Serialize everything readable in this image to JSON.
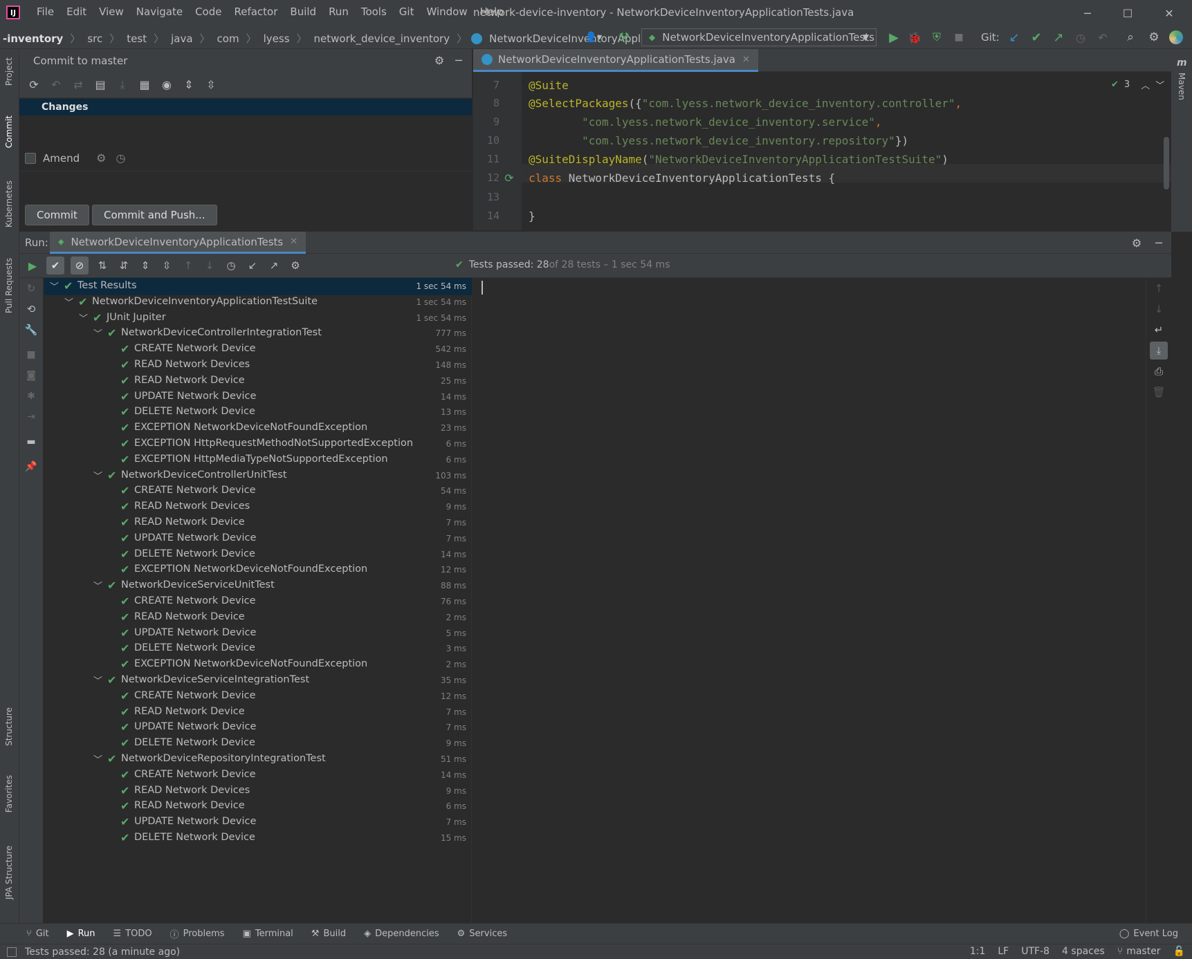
{
  "app": {
    "window_title": "network-device-inventory - NetworkDeviceInventoryApplicationTests.java",
    "menu": [
      "File",
      "Edit",
      "View",
      "Navigate",
      "Code",
      "Refactor",
      "Build",
      "Run",
      "Tools",
      "Git",
      "Window",
      "Help"
    ]
  },
  "breadcrumbs": [
    "-inventory",
    "src",
    "test",
    "java",
    "com",
    "lyess",
    "network_device_inventory",
    "NetworkDeviceInventoryApplicationTests"
  ],
  "run_config": "NetworkDeviceInventoryApplicationTests",
  "git_label": "Git:",
  "left_strip": [
    "Project",
    "Commit",
    "Kubernetes",
    "Pull Requests",
    "Structure",
    "Favorites",
    "JPA Structure"
  ],
  "right_strip": [
    "Maven"
  ],
  "commit": {
    "title": "Commit to master",
    "changes_label": "Changes",
    "amend_label": "Amend",
    "commit_button": "Commit",
    "commit_push_button": "Commit and Push..."
  },
  "editor": {
    "tab": "NetworkDeviceInventoryApplicationTests.java",
    "inspection_count": "3",
    "lines": [
      {
        "n": "7"
      },
      {
        "n": "8"
      },
      {
        "n": "9"
      },
      {
        "n": "10"
      },
      {
        "n": "11"
      },
      {
        "n": "12"
      },
      {
        "n": "13"
      },
      {
        "n": "14"
      }
    ],
    "code": {
      "l7": "@Suite",
      "l8a": "@SelectPackages",
      "l8b": "({",
      "l8c": "\"com.lyess.network_device_inventory.controller\"",
      "l8d": ",",
      "l9a": "        ",
      "l9b": "\"com.lyess.network_device_inventory.service\"",
      "l9c": ",",
      "l10a": "        ",
      "l10b": "\"com.lyess.network_device_inventory.repository\"",
      "l10c": "})",
      "l11a": "@SuiteDisplayName",
      "l11b": "(",
      "l11c": "\"NetworkDeviceInventoryApplicationTestSuite\"",
      "l11d": ")",
      "l12a": "class",
      "l12b": " NetworkDeviceInventoryApplicationTests {",
      "l14": "}"
    }
  },
  "run": {
    "label": "Run:",
    "tab": "NetworkDeviceInventoryApplicationTests",
    "summary_prefix": "Tests passed: 28",
    "summary_suffix": " of 28 tests – 1 sec 54 ms"
  },
  "tree": [
    {
      "label": "Test Results",
      "dur": "1 sec 54 ms",
      "level": 0,
      "arrow": true
    },
    {
      "label": "NetworkDeviceInventoryApplicationTestSuite",
      "dur": "1 sec 54 ms",
      "level": 1,
      "arrow": true
    },
    {
      "label": "JUnit Jupiter",
      "dur": "1 sec 54 ms",
      "level": 2,
      "arrow": true
    },
    {
      "label": "NetworkDeviceControllerIntegrationTest",
      "dur": "777 ms",
      "level": 3,
      "arrow": true
    },
    {
      "label": "CREATE Network Device",
      "dur": "542 ms",
      "level": 4
    },
    {
      "label": "READ Network Devices",
      "dur": "148 ms",
      "level": 4
    },
    {
      "label": "READ Network Device",
      "dur": "25 ms",
      "level": 4
    },
    {
      "label": "UPDATE Network Device",
      "dur": "14 ms",
      "level": 4
    },
    {
      "label": "DELETE Network Device",
      "dur": "13 ms",
      "level": 4
    },
    {
      "label": "EXCEPTION NetworkDeviceNotFoundException",
      "dur": "23 ms",
      "level": 4
    },
    {
      "label": "EXCEPTION HttpRequestMethodNotSupportedException",
      "dur": "6 ms",
      "level": 4
    },
    {
      "label": "EXCEPTION HttpMediaTypeNotSupportedException",
      "dur": "6 ms",
      "level": 4
    },
    {
      "label": "NetworkDeviceControllerUnitTest",
      "dur": "103 ms",
      "level": 3,
      "arrow": true
    },
    {
      "label": "CREATE Network Device",
      "dur": "54 ms",
      "level": 4
    },
    {
      "label": "READ Network Devices",
      "dur": "9 ms",
      "level": 4
    },
    {
      "label": "READ Network Device",
      "dur": "7 ms",
      "level": 4
    },
    {
      "label": "UPDATE Network Device",
      "dur": "7 ms",
      "level": 4
    },
    {
      "label": "DELETE Network Device",
      "dur": "14 ms",
      "level": 4
    },
    {
      "label": "EXCEPTION NetworkDeviceNotFoundException",
      "dur": "12 ms",
      "level": 4
    },
    {
      "label": "NetworkDeviceServiceUnitTest",
      "dur": "88 ms",
      "level": 3,
      "arrow": true
    },
    {
      "label": "CREATE Network Device",
      "dur": "76 ms",
      "level": 4
    },
    {
      "label": "READ Network Device",
      "dur": "2 ms",
      "level": 4
    },
    {
      "label": "UPDATE Network Device",
      "dur": "5 ms",
      "level": 4
    },
    {
      "label": "DELETE Network Device",
      "dur": "3 ms",
      "level": 4
    },
    {
      "label": "EXCEPTION NetworkDeviceNotFoundException",
      "dur": "2 ms",
      "level": 4
    },
    {
      "label": "NetworkDeviceServiceIntegrationTest",
      "dur": "35 ms",
      "level": 3,
      "arrow": true
    },
    {
      "label": "CREATE Network Device",
      "dur": "12 ms",
      "level": 4
    },
    {
      "label": "READ Network Device",
      "dur": "7 ms",
      "level": 4
    },
    {
      "label": "UPDATE Network Device",
      "dur": "7 ms",
      "level": 4
    },
    {
      "label": "DELETE Network Device",
      "dur": "9 ms",
      "level": 4
    },
    {
      "label": "NetworkDeviceRepositoryIntegrationTest",
      "dur": "51 ms",
      "level": 3,
      "arrow": true
    },
    {
      "label": "CREATE Network Device",
      "dur": "14 ms",
      "level": 4
    },
    {
      "label": "READ Network Devices",
      "dur": "9 ms",
      "level": 4
    },
    {
      "label": "READ Network Device",
      "dur": "6 ms",
      "level": 4
    },
    {
      "label": "UPDATE Network Device",
      "dur": "7 ms",
      "level": 4
    },
    {
      "label": "DELETE Network Device",
      "dur": "15 ms",
      "level": 4
    }
  ],
  "bottom_tools": [
    "Git",
    "Run",
    "TODO",
    "Problems",
    "Terminal",
    "Build",
    "Dependencies",
    "Services"
  ],
  "event_log": "Event Log",
  "status": {
    "message": "Tests passed: 28 (a minute ago)",
    "position": "1:1",
    "line_sep": "LF",
    "encoding": "UTF-8",
    "indent": "4 spaces",
    "branch": "master"
  },
  "colors": {
    "bg": "#2b2b2b",
    "panel": "#3c3f41",
    "selection": "#0d293e",
    "pass_green": "#59a869",
    "accent": "#4a88c7"
  }
}
